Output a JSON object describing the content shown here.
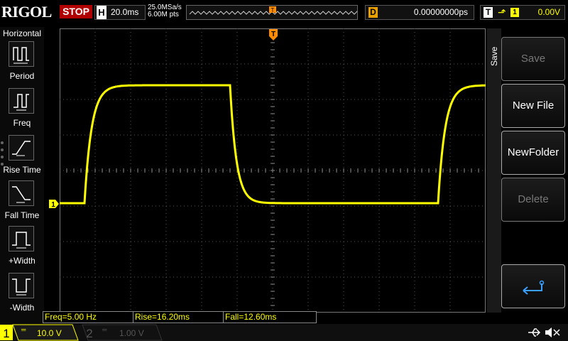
{
  "header": {
    "brand": "RIGOL",
    "run_state": "STOP",
    "timebase_letter": "H",
    "timebase": "20.0ms",
    "sample_rate": "25.0MSa/s",
    "memory_depth": "6.00M pts",
    "delay_letter": "D",
    "delay_value": "0.00000000ps",
    "trigger_letter": "T",
    "trigger_channel": "1",
    "trigger_level": "0.00V"
  },
  "left_menu": {
    "title": "Horizontal",
    "items": [
      {
        "label": "Period",
        "icon": "period-icon"
      },
      {
        "label": "Freq",
        "icon": "freq-icon"
      },
      {
        "label": "Rise Time",
        "icon": "rise-time-icon"
      },
      {
        "label": "Fall Time",
        "icon": "fall-time-icon"
      },
      {
        "label": "+Width",
        "icon": "positive-width-icon"
      },
      {
        "label": "-Width",
        "icon": "negative-width-icon"
      }
    ]
  },
  "right_menu": {
    "tab": "Save",
    "buttons": [
      {
        "label": "Save",
        "state": "disabled"
      },
      {
        "label": "New File",
        "state": "enabled"
      },
      {
        "label": "NewFolder",
        "state": "enabled"
      },
      {
        "label": "Delete",
        "state": "disabled"
      },
      {
        "label": "",
        "state": "enabled",
        "icon": "return-icon"
      }
    ]
  },
  "measurements": [
    {
      "label": "Freq=5.00 Hz"
    },
    {
      "label": "Rise=16.20ms"
    },
    {
      "label": "Fall=12.60ms"
    }
  ],
  "channels": [
    {
      "number": "1",
      "scale": "10.0 V",
      "color": "#ffff00",
      "active": true
    },
    {
      "number": "2",
      "scale": "1.00 V",
      "color": "#00c8ff",
      "active": false
    }
  ],
  "markers": {
    "channel1_ground": "1",
    "trigger_position": "T"
  },
  "colors": {
    "trace": "#ffff00",
    "trigger_marker": "#ff8c00",
    "stop": "#b00000",
    "delay_accent": "#e8a000"
  }
}
